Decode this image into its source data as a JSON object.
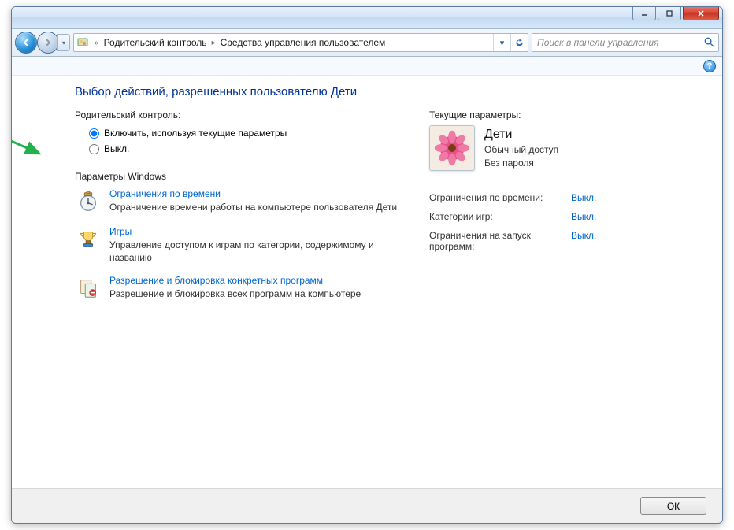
{
  "titlebar": {},
  "nav": {
    "breadcrumb": {
      "overflow": "«",
      "seg1": "Родительский контроль",
      "seg2": "Средства управления пользователем"
    },
    "search_placeholder": "Поиск в панели управления"
  },
  "page": {
    "title": "Выбор действий, разрешенных пользователю Дети"
  },
  "parental": {
    "group_label": "Родительский контроль:",
    "opt_on": "Включить, используя текущие параметры",
    "opt_off": "Выкл."
  },
  "windows_settings": {
    "section_label": "Параметры Windows",
    "items": [
      {
        "link": "Ограничения по времени",
        "desc": "Ограничение времени работы на компьютере пользователя Дети"
      },
      {
        "link": "Игры",
        "desc": "Управление доступом к играм по категории, содержимому и названию"
      },
      {
        "link": "Разрешение и блокировка конкретных программ",
        "desc": "Разрешение и блокировка всех программ на компьютере"
      }
    ]
  },
  "right": {
    "header": "Текущие параметры:",
    "user": {
      "name": "Дети",
      "access": "Обычный доступ",
      "password": "Без пароля"
    },
    "rows": [
      {
        "k": "Ограничения по времени:",
        "v": "Выкл."
      },
      {
        "k": "Категории игр:",
        "v": "Выкл."
      },
      {
        "k": "Ограничения на запуск программ:",
        "v": "Выкл."
      }
    ]
  },
  "footer": {
    "ok": "ОК"
  }
}
